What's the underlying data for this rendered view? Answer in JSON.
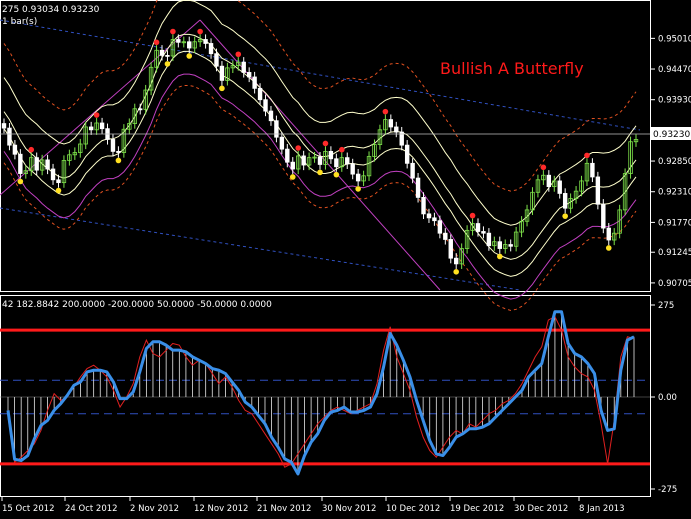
{
  "header": {
    "prices": "275 0.93034 0.93230",
    "bars_label": "1 bar(s)"
  },
  "annotation": "Bullish A Butterfly",
  "current_price": "0.93230",
  "oscillator_header": "42 182.8842 200.0000 -200.0000 50.0000 -50.0000 0.0000",
  "colors": {
    "background": "#000000",
    "bull_candle": "#7ee24a",
    "bear_candle": "#ffffff",
    "inner_band": "#ffffcc",
    "outer_band": "#e05020",
    "magenta_band": "#c040c0",
    "trendline": "#3050c0",
    "oscillator_line": "#3a8fe8",
    "signal_line": "#e02020",
    "threshold": "#ff1a1a",
    "fractal_high": "#ff2a2a",
    "fractal_low": "#ffe020"
  },
  "chart_data": [
    {
      "type": "candlestick",
      "title": "",
      "ylim": [
        0.9058,
        0.9565
      ],
      "y_ticks": [
        "0.95010",
        "0.94470",
        "0.93930",
        "0.93390",
        "0.92850",
        "0.92310",
        "0.91770",
        "0.91245",
        "0.90705"
      ],
      "x_ticks": [
        "15 Oct 2012",
        "24 Oct 2012",
        "2 Nov 2012",
        "12 Nov 2012",
        "21 Nov 2012",
        "30 Nov 2012",
        "10 Dec 2012",
        "19 Dec 2012",
        "30 Dec 2012",
        "8 Jan 2013"
      ],
      "close": [
        0.9343,
        0.9313,
        0.9297,
        0.9263,
        0.9268,
        0.9291,
        0.9269,
        0.9287,
        0.9271,
        0.9252,
        0.9247,
        0.9286,
        0.9296,
        0.93,
        0.9315,
        0.9345,
        0.934,
        0.9352,
        0.9342,
        0.9323,
        0.9302,
        0.93,
        0.9341,
        0.9351,
        0.9377,
        0.9376,
        0.941,
        0.945,
        0.948,
        0.9471,
        0.947,
        0.9499,
        0.9494,
        0.9495,
        0.9484,
        0.9495,
        0.9499,
        0.9492,
        0.9474,
        0.9452,
        0.9427,
        0.9449,
        0.9453,
        0.9459,
        0.9441,
        0.9433,
        0.9413,
        0.9393,
        0.9373,
        0.9356,
        0.9327,
        0.9306,
        0.9283,
        0.9271,
        0.9294,
        0.9278,
        0.9291,
        0.9292,
        0.9279,
        0.9302,
        0.9289,
        0.9275,
        0.9291,
        0.928,
        0.9262,
        0.925,
        0.9259,
        0.9293,
        0.9314,
        0.934,
        0.9358,
        0.9345,
        0.9336,
        0.9313,
        0.9281,
        0.9255,
        0.9221,
        0.9192,
        0.9185,
        0.918,
        0.9158,
        0.9147,
        0.9114,
        0.9104,
        0.9131,
        0.9163,
        0.9175,
        0.9161,
        0.9158,
        0.9136,
        0.9143,
        0.9131,
        0.9138,
        0.9135,
        0.916,
        0.9179,
        0.9199,
        0.923,
        0.9252,
        0.926,
        0.924,
        0.925,
        0.9228,
        0.9202,
        0.9219,
        0.9232,
        0.925,
        0.9281,
        0.9257,
        0.9209,
        0.9167,
        0.9146,
        0.9158,
        0.9199,
        0.9263,
        0.9319,
        0.9323
      ],
      "series": [
        {
          "name": "",
          "type": "band-inner",
          "values_upper": [
            0.9432,
            0.9418,
            0.94,
            0.9382,
            0.9367,
            0.9358,
            0.935,
            0.934,
            0.9332,
            0.9325,
            0.9318,
            0.9315,
            0.9318,
            0.9326,
            0.9338,
            0.9353,
            0.9363,
            0.9373,
            0.9381,
            0.9384,
            0.9384,
            0.9388,
            0.9396,
            0.9408,
            0.9423,
            0.9441,
            0.946,
            0.9481,
            0.9506,
            0.9527,
            0.9542,
            0.9556,
            0.9565,
            0.9568,
            0.9568,
            0.9566,
            0.9561,
            0.9556,
            0.955,
            0.9538,
            0.9526,
            0.9521,
            0.9515,
            0.9507,
            0.95,
            0.9492,
            0.9484,
            0.9474,
            0.9465,
            0.9454,
            0.944,
            0.9425,
            0.9411,
            0.9397,
            0.9388,
            0.9375,
            0.9364,
            0.9357,
            0.9353,
            0.9353,
            0.9355,
            0.9361,
            0.9366,
            0.937,
            0.9371,
            0.9369,
            0.9368,
            0.9371,
            0.9376,
            0.9385,
            0.9392,
            0.9396,
            0.9397,
            0.9396,
            0.9391,
            0.9382,
            0.937,
            0.9357,
            0.9344,
            0.933,
            0.9315,
            0.93,
            0.9287,
            0.9271,
            0.9257,
            0.9245,
            0.9231,
            0.9218,
            0.9206,
            0.9194,
            0.9184,
            0.9179,
            0.9175,
            0.9172,
            0.9174,
            0.9179,
            0.9187,
            0.9198,
            0.9212,
            0.9225,
            0.9238,
            0.9251,
            0.9262,
            0.9267,
            0.9273,
            0.9279,
            0.9286,
            0.9295,
            0.93,
            0.93,
            0.9299,
            0.93,
            0.9304,
            0.931,
            0.932,
            0.9334,
            0.9347
          ]
        },
        {
          "name": "",
          "type": "band-outer",
          "values_upper": [
            0.9492,
            0.9478,
            0.946,
            0.9442,
            0.9427,
            0.9418,
            0.941,
            0.94,
            0.9392,
            0.9385,
            0.9378,
            0.9375,
            0.9378,
            0.9386,
            0.9398,
            0.9413,
            0.9423,
            0.9433,
            0.9441,
            0.9444,
            0.9444,
            0.9448,
            0.9456,
            0.9468,
            0.9483,
            0.9501,
            0.952,
            0.9541,
            0.9566,
            0.9587,
            0.9602,
            0.9616,
            0.9625,
            0.9628,
            0.9628,
            0.9626,
            0.9621,
            0.9616,
            0.961,
            0.9598,
            0.9586,
            0.9581,
            0.9575,
            0.9567,
            0.956,
            0.9552,
            0.9544,
            0.9534,
            0.9525,
            0.9514,
            0.95,
            0.9485,
            0.9471,
            0.9457,
            0.9448,
            0.9435,
            0.9424,
            0.9417,
            0.9413,
            0.9413,
            0.9415,
            0.9421,
            0.9426,
            0.943,
            0.9431,
            0.9429,
            0.9428,
            0.9431,
            0.9436,
            0.9445,
            0.9452,
            0.9456,
            0.9457,
            0.9456,
            0.9451,
            0.9442,
            0.943,
            0.9417,
            0.9404,
            0.939,
            0.9375,
            0.936,
            0.9347,
            0.9331,
            0.9317,
            0.9305,
            0.9291,
            0.9278,
            0.9266,
            0.9254,
            0.9244,
            0.9239,
            0.9235,
            0.9232,
            0.9234,
            0.9239,
            0.9247,
            0.9258,
            0.9272,
            0.9285,
            0.9298,
            0.9311,
            0.9322,
            0.9327,
            0.9333,
            0.9339,
            0.9346,
            0.9355,
            0.936,
            0.936,
            0.9359,
            0.936,
            0.9364,
            0.937,
            0.938,
            0.9394,
            0.9407
          ]
        },
        {
          "name": "",
          "type": "oscillator",
          "values": [
            -40,
            -186,
            -190,
            -175,
            -125,
            -85,
            -70,
            -40,
            -20,
            5,
            35,
            45,
            75,
            80,
            80,
            75,
            45,
            -5,
            -5,
            15,
            75,
            145,
            165,
            165,
            155,
            140,
            140,
            135,
            120,
            110,
            100,
            85,
            80,
            70,
            45,
            20,
            -15,
            -30,
            -55,
            -80,
            -120,
            -150,
            -185,
            -195,
            -230,
            -175,
            -135,
            -110,
            -70,
            -45,
            -40,
            -30,
            -45,
            -45,
            -40,
            -30,
            10,
            90,
            190,
            155,
            110,
            60,
            -10,
            -70,
            -130,
            -170,
            -175,
            -150,
            -120,
            -110,
            -95,
            -95,
            -90,
            -80,
            -60,
            -40,
            -20,
            0,
            20,
            60,
            80,
            100,
            180,
            255,
            255,
            160,
            130,
            120,
            100,
            70,
            -40,
            -100,
            -95,
            80,
            170,
            180
          ]
        },
        {
          "name": "",
          "type": "signal",
          "values": [
            -60,
            -195,
            -180,
            -160,
            -140,
            -100,
            -40,
            10,
            -10,
            0,
            30,
            60,
            85,
            95,
            80,
            60,
            20,
            -30,
            0,
            40,
            120,
            170,
            130,
            120,
            140,
            160,
            155,
            120,
            95,
            110,
            100,
            70,
            40,
            60,
            30,
            -10,
            -40,
            -50,
            -80,
            -110,
            -140,
            -170,
            -210,
            -200,
            -170,
            -140,
            -110,
            -80,
            -60,
            -40,
            -30,
            -40,
            -50,
            -40,
            -30,
            -20,
            40,
            140,
            210,
            120,
            70,
            20,
            -60,
            -120,
            -160,
            -180,
            -150,
            -120,
            -100,
            -110,
            -80,
            -90,
            -70,
            -50,
            -40,
            -20,
            -10,
            10,
            40,
            80,
            120,
            150,
            230,
            240,
            200,
            120,
            90,
            70,
            60,
            20,
            -80,
            -200,
            -70,
            120,
            180,
            175
          ]
        }
      ]
    },
    {
      "type": "oscillator-panel",
      "y_ticks": [
        "275",
        "0.00",
        "-275"
      ],
      "levels": [
        200,
        50,
        0,
        -50,
        -200
      ],
      "ylim": [
        -275,
        275
      ]
    }
  ]
}
